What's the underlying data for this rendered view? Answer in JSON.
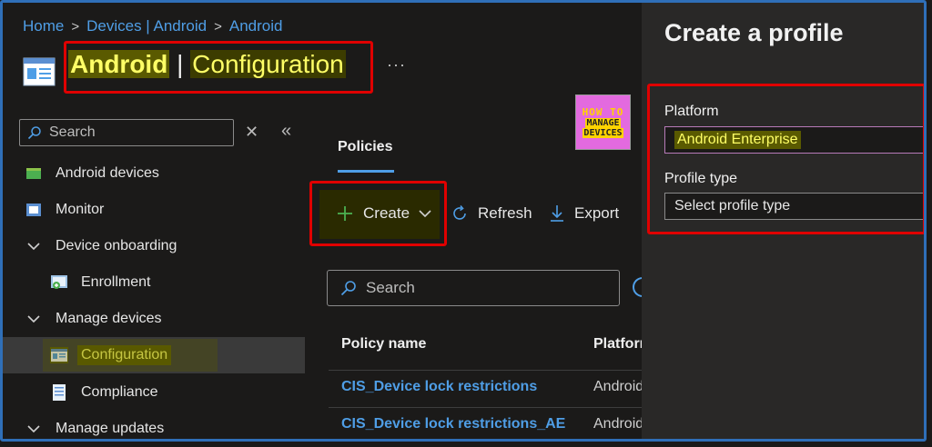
{
  "breadcrumb": {
    "items": [
      "Home",
      "Devices | Android",
      "Android"
    ]
  },
  "header": {
    "title_part1": "Android",
    "title_sep": " | ",
    "title_part2": "Configuration",
    "more": "···"
  },
  "sidebar": {
    "search_placeholder": "Search",
    "items": [
      {
        "label": "Android devices",
        "icon": "device-icon"
      },
      {
        "label": "Monitor",
        "icon": "monitor-icon"
      },
      {
        "label": "Device onboarding",
        "icon": "chevron-down-icon"
      },
      {
        "label": "Enrollment",
        "icon": "enrollment-icon"
      },
      {
        "label": "Manage devices",
        "icon": "chevron-down-icon"
      },
      {
        "label": "Configuration",
        "icon": "configuration-icon"
      },
      {
        "label": "Compliance",
        "icon": "compliance-icon"
      },
      {
        "label": "Manage updates",
        "icon": "chevron-down-icon"
      }
    ]
  },
  "main": {
    "tab": "Policies",
    "logo": {
      "line1": "HOW TO",
      "line2": "MANAGE",
      "line3": "DEVICES"
    },
    "toolbar": {
      "create": "Create",
      "refresh": "Refresh",
      "export": "Export"
    },
    "search_placeholder": "Search",
    "table": {
      "columns": [
        "Policy name",
        "Platform"
      ],
      "rows": [
        {
          "name": "CIS_Device lock restrictions",
          "platform": "Android"
        },
        {
          "name": "CIS_Device lock restrictions_AE",
          "platform": "Android"
        }
      ]
    }
  },
  "panel": {
    "title": "Create a profile",
    "platform_label": "Platform",
    "platform_value": "Android Enterprise",
    "profile_type_label": "Profile type",
    "profile_type_placeholder": "Select profile type"
  },
  "colors": {
    "accent": "#4f9ee6",
    "highlight": "#ffff66",
    "annotation": "#e00000",
    "background": "#1b1a19",
    "panel": "#292827"
  }
}
